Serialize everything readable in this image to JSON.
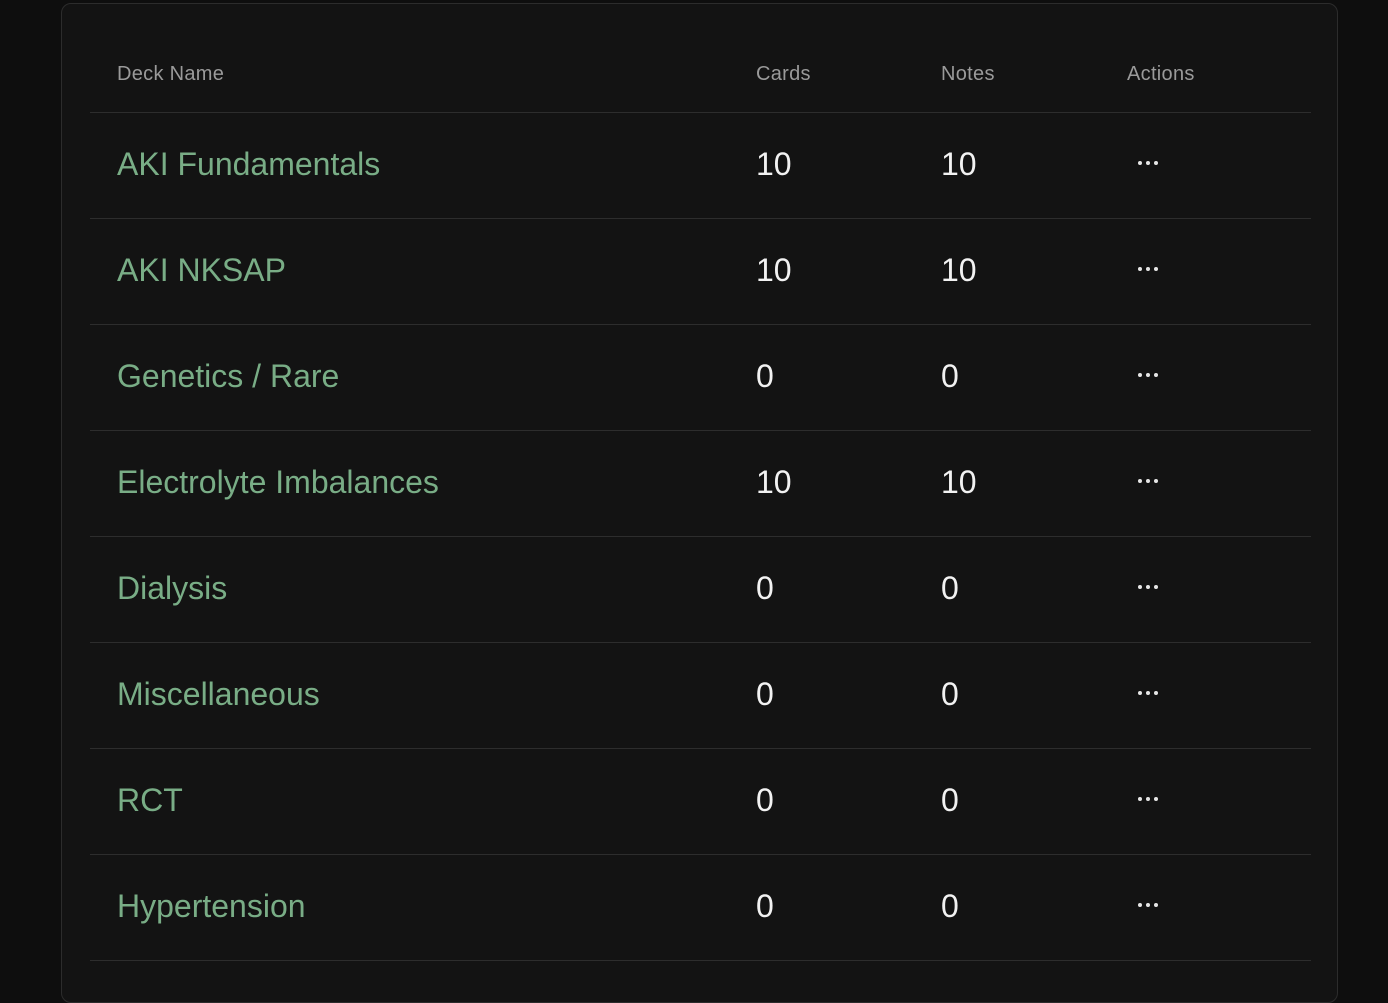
{
  "table": {
    "headers": {
      "deck_name": "Deck Name",
      "cards": "Cards",
      "notes": "Notes",
      "actions": "Actions"
    },
    "rows": [
      {
        "name": "AKI Fundamentals",
        "cards": "10",
        "notes": "10"
      },
      {
        "name": "AKI NKSAP",
        "cards": "10",
        "notes": "10"
      },
      {
        "name": "Genetics / Rare",
        "cards": "0",
        "notes": "0"
      },
      {
        "name": "Electrolyte Imbalances",
        "cards": "10",
        "notes": "10"
      },
      {
        "name": "Dialysis",
        "cards": "0",
        "notes": "0"
      },
      {
        "name": "Miscellaneous",
        "cards": "0",
        "notes": "0"
      },
      {
        "name": "RCT",
        "cards": "0",
        "notes": "0"
      },
      {
        "name": "Hypertension",
        "cards": "0",
        "notes": "0"
      }
    ]
  },
  "icons": {
    "row_actions": "more-horizontal-icon"
  },
  "colors": {
    "background": "#0e0e0e",
    "panel": "#131313",
    "deck_link": "#79ad86",
    "value_text": "#f2f2f2",
    "header_text": "#9a9a9a",
    "divider": "#2d2d2d"
  }
}
